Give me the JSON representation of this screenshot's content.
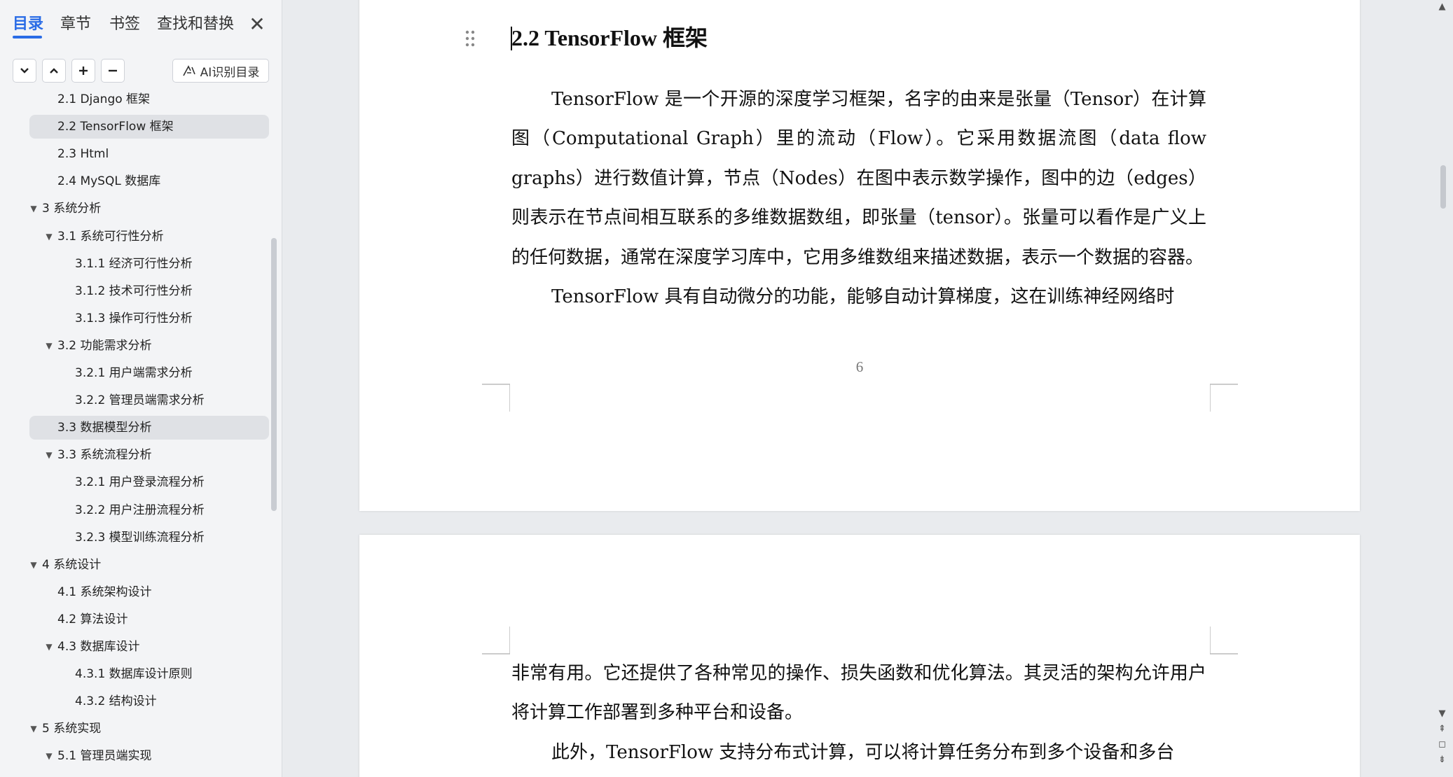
{
  "sidebar": {
    "tabs": [
      "目录",
      "章节",
      "书签",
      "查找和替换"
    ],
    "close_glyph": "✕",
    "ai_button_label": "AI识别目录",
    "toolbar_icons": [
      "chevron-down-icon",
      "chevron-up-icon",
      "plus-icon",
      "minus-icon"
    ],
    "toc": [
      {
        "level": 2,
        "label": "2.1 Django 框架",
        "arrow": false,
        "selected": false
      },
      {
        "level": 2,
        "label": "2.2 TensorFlow 框架",
        "arrow": false,
        "selected": true
      },
      {
        "level": 2,
        "label": "2.3 Html",
        "arrow": false,
        "selected": false
      },
      {
        "level": 2,
        "label": "2.4 MySQL 数据库",
        "arrow": false,
        "selected": false
      },
      {
        "level": 1,
        "label": "3  系统分析",
        "arrow": true,
        "selected": false
      },
      {
        "level": 2,
        "label": "3.1  系统可行性分析",
        "arrow": true,
        "selected": false
      },
      {
        "level": 3,
        "label": "3.1.1  经济可行性分析",
        "arrow": false,
        "selected": false
      },
      {
        "level": 3,
        "label": "3.1.2  技术可行性分析",
        "arrow": false,
        "selected": false
      },
      {
        "level": 3,
        "label": "3.1.3  操作可行性分析",
        "arrow": false,
        "selected": false
      },
      {
        "level": 2,
        "label": "3.2  功能需求分析",
        "arrow": true,
        "selected": false
      },
      {
        "level": 3,
        "label": "3.2.1  用户端需求分析",
        "arrow": false,
        "selected": false
      },
      {
        "level": 3,
        "label": "3.2.2  管理员端需求分析",
        "arrow": false,
        "selected": false
      },
      {
        "level": 2,
        "label": "3.3  数据模型分析",
        "arrow": false,
        "selected": true
      },
      {
        "level": 2,
        "label": "3.3  系统流程分析",
        "arrow": true,
        "selected": false
      },
      {
        "level": 3,
        "label": "3.2.1  用户登录流程分析",
        "arrow": false,
        "selected": false
      },
      {
        "level": 3,
        "label": "3.2.2  用户注册流程分析",
        "arrow": false,
        "selected": false
      },
      {
        "level": 3,
        "label": "3.2.3  模型训练流程分析",
        "arrow": false,
        "selected": false
      },
      {
        "level": 1,
        "label": "4  系统设计",
        "arrow": true,
        "selected": false
      },
      {
        "level": 2,
        "label": "4.1  系统架构设计",
        "arrow": false,
        "selected": false
      },
      {
        "level": 2,
        "label": "4.2  算法设计",
        "arrow": false,
        "selected": false
      },
      {
        "level": 2,
        "label": "4.3  数据库设计",
        "arrow": true,
        "selected": false
      },
      {
        "level": 3,
        "label": "4.3.1  数据库设计原则",
        "arrow": false,
        "selected": false
      },
      {
        "level": 3,
        "label": "4.3.2  结构设计",
        "arrow": false,
        "selected": false
      },
      {
        "level": 1,
        "label": "5  系统实现",
        "arrow": true,
        "selected": false
      },
      {
        "level": 2,
        "label": "5.1  管理员端实现",
        "arrow": true,
        "selected": false
      }
    ]
  },
  "document": {
    "heading": "2.2 TensorFlow 框架",
    "page1_paragraphs": [
      "TensorFlow 是一个开源的深度学习框架，名字的由来是张量（Tensor）在计算图（Computational Graph）里的流动（Flow）。它采用数据流图（data flow graphs）进行数值计算，节点（Nodes）在图中表示数学操作，图中的边（edges）则表示在节点间相互联系的多维数据数组，即张量（tensor）。张量可以看作是广义上的任何数据，通常在深度学习库中，它用多维数组来描述数据，表示一个数据的容器。",
      "TensorFlow 具有自动微分的功能，能够自动计算梯度，这在训练神经网络时"
    ],
    "page_number": "6",
    "page2_paragraphs": [
      "非常有用。它还提供了各种常见的操作、损失函数和优化算法。其灵活的架构允许用户将计算工作部署到多种平台和设备。",
      "此外，TensorFlow 支持分布式计算，可以将计算任务分布到多个设备和多台"
    ]
  },
  "colors": {
    "accent": "#2a6ce6",
    "sidebar_bg": "#f3f4f6",
    "selected_bg": "#dfe1e5",
    "canvas_bg": "#e9ebee"
  }
}
